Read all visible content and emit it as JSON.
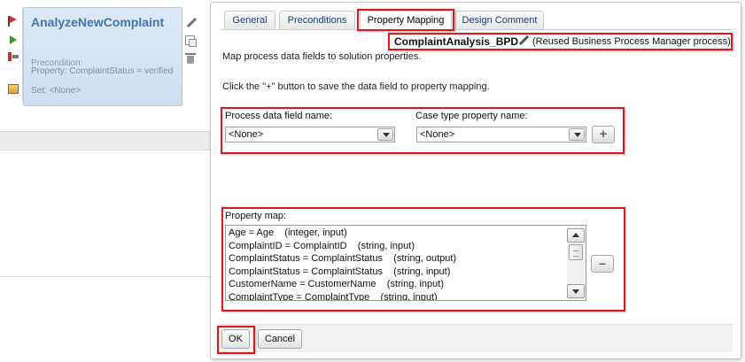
{
  "activity": {
    "name": "AnalyzeNewComplaint",
    "precondition_label": "Precondition:",
    "precondition_value": "Property: ComplaintStatus = verified",
    "set_text": "Set: <None>"
  },
  "tabs": [
    {
      "label": "General",
      "active": false
    },
    {
      "label": "Preconditions",
      "active": false
    },
    {
      "label": "Property Mapping",
      "active": true
    },
    {
      "label": "Design Comment",
      "active": false
    }
  ],
  "bpd": {
    "name": "ComplaintAnalysis_BPD",
    "description": "(Reused Business Process Manager process)"
  },
  "text": {
    "intro": "Map process data fields to solution properties.",
    "hint": "Click the \"+\" button to save the data field to property mapping."
  },
  "mapping": {
    "process_field_label": "Process data field name:",
    "process_field_value": "<None>",
    "case_property_label": "Case type property name:",
    "case_property_value": "<None>",
    "add_label": "+"
  },
  "property_map": {
    "label": "Property map:",
    "items": [
      "Age = Age    (integer, input)",
      "ComplaintID = ComplaintID    (string, input)",
      "ComplaintStatus = ComplaintStatus    (string, output)",
      "ComplaintStatus = ComplaintStatus    (string, input)",
      "CustomerName = CustomerName    (string, input)",
      "ComplaintType = ComplaintType    (string, input)"
    ],
    "remove_label": "−"
  },
  "buttons": {
    "ok": "OK",
    "cancel": "Cancel"
  },
  "colors": {
    "highlight": "#e0161a",
    "activity_title": "#3f76b0",
    "card_background": "#d6e4f3"
  },
  "icons": [
    "flag-icon",
    "play-icon",
    "map-tool-icon",
    "image-icon",
    "pencil-icon",
    "copy-icon",
    "trash-icon",
    "scroll-up-icon",
    "scroll-down-icon"
  ]
}
